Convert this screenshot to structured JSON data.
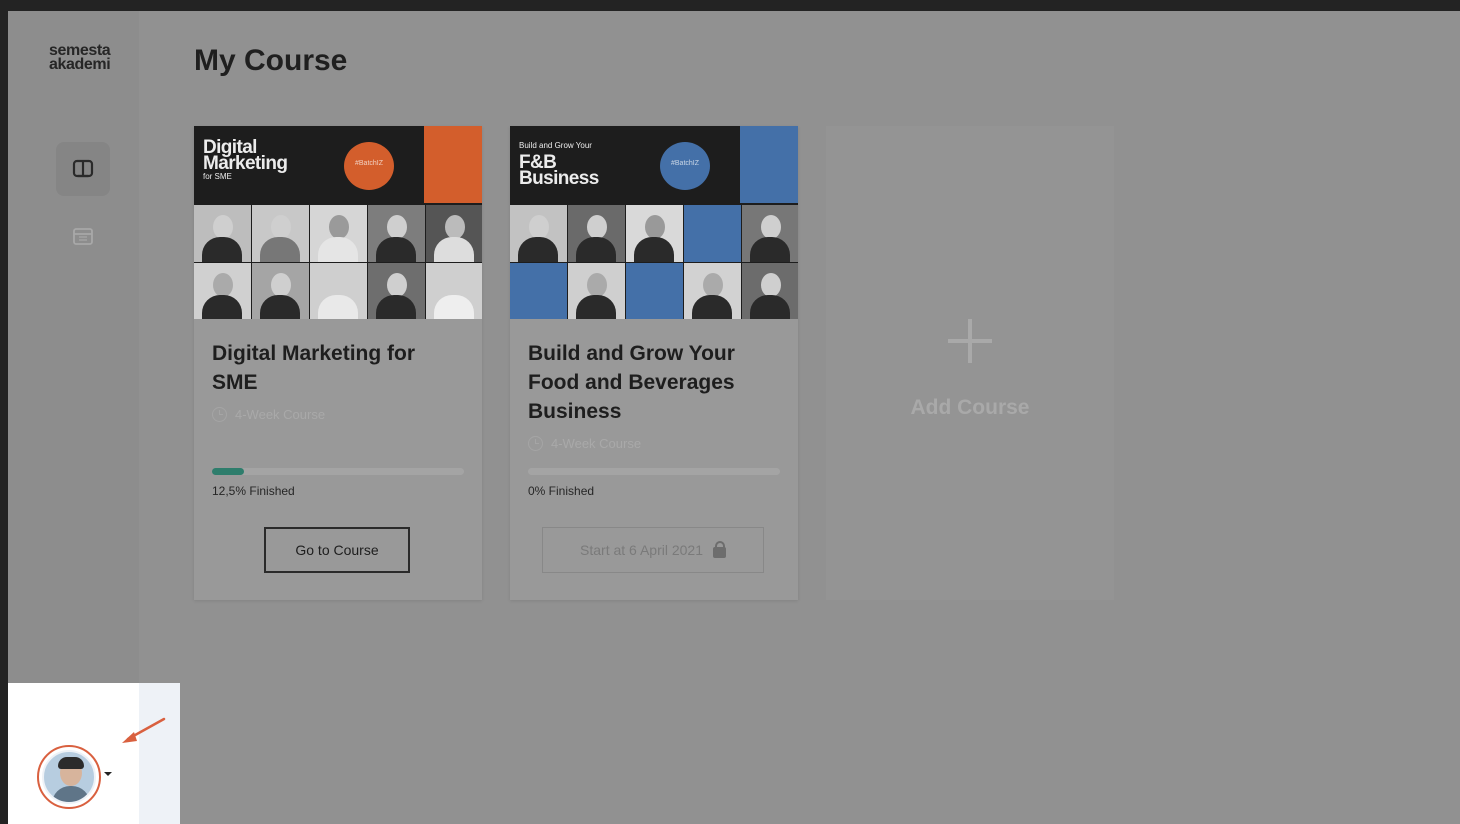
{
  "sidebar": {
    "logo_line1": "semesta",
    "logo_line2": "akademi"
  },
  "page": {
    "title": "My Course"
  },
  "courses": [
    {
      "banner_small_top": "",
      "banner_title_line1": "Digital",
      "banner_title_line2": "Marketing",
      "banner_subtitle": "for SME",
      "banner_badge": "#BatchIZ",
      "banner_accent": "#d35e2c",
      "name": "Digital Marketing for SME",
      "duration": "4-Week Course",
      "progress": 0.125,
      "progress_label": "12,5% Finished",
      "button_label": "Go to Course",
      "button_locked": false
    },
    {
      "banner_small_top": "Build and Grow Your",
      "banner_title_line1": "F&B",
      "banner_title_line2": "Business",
      "banner_subtitle": "",
      "banner_badge": "#BatchIZ",
      "banner_accent": "#4470a8",
      "name": "Build and Grow Your Food and Beverages Business",
      "duration": "4-Week Course",
      "progress": 0,
      "progress_label": "0% Finished",
      "button_label": "Start at 6 April 2021",
      "button_locked": true
    }
  ],
  "add_course": {
    "label": "Add Course"
  },
  "colors": {
    "progress_fill": "#2e7d6c",
    "highlight_ring": "#d9603f"
  }
}
